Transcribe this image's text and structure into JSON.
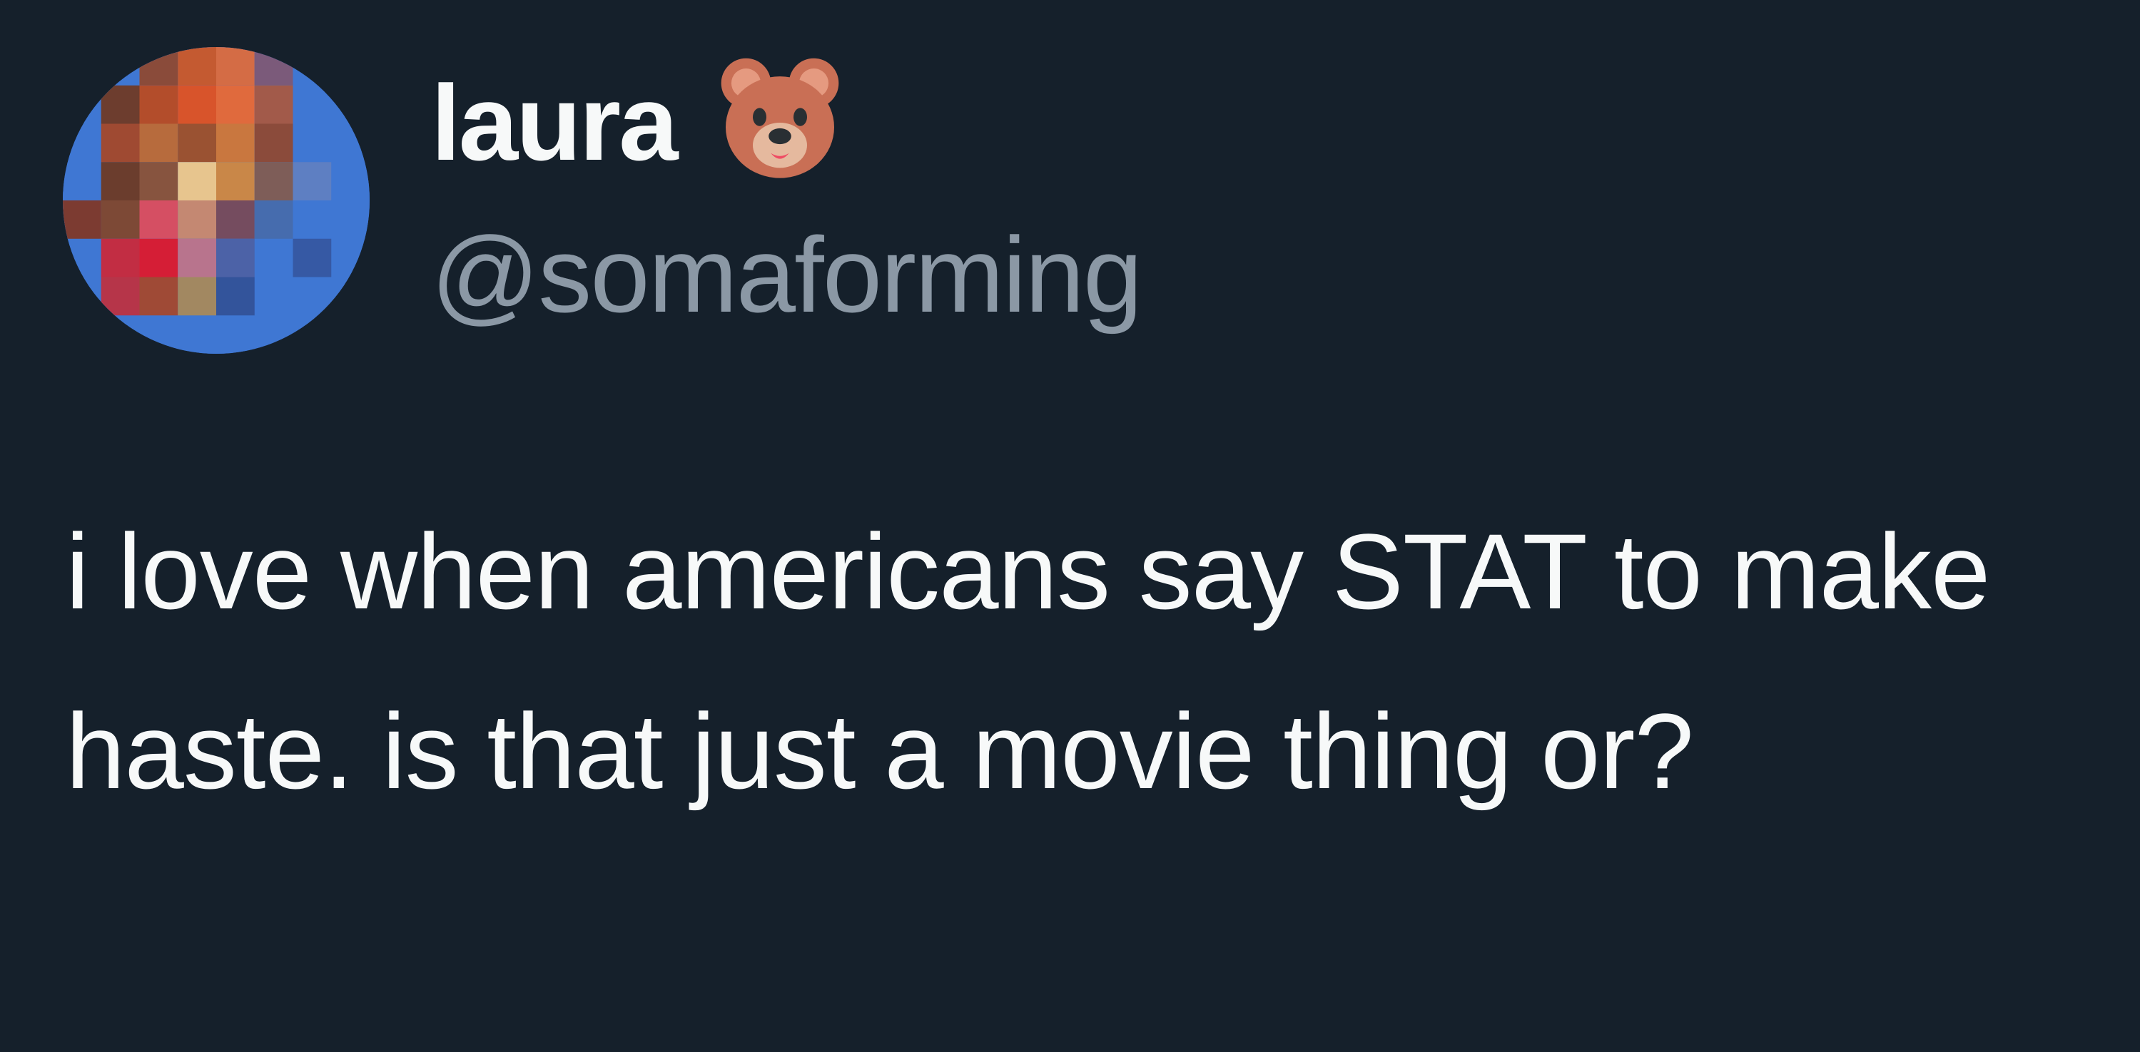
{
  "tweet": {
    "author": {
      "display_name": "laura",
      "emoji_icon": "bear-face-icon",
      "handle": "@somaforming",
      "avatar": "pixelated-profile-photo"
    },
    "text": "i love when americans say STAT to make haste. is that just a movie thing or?"
  },
  "colors": {
    "background": "#15202b",
    "primary_text": "#f7f9f9",
    "secondary_text": "#8b98a5"
  }
}
